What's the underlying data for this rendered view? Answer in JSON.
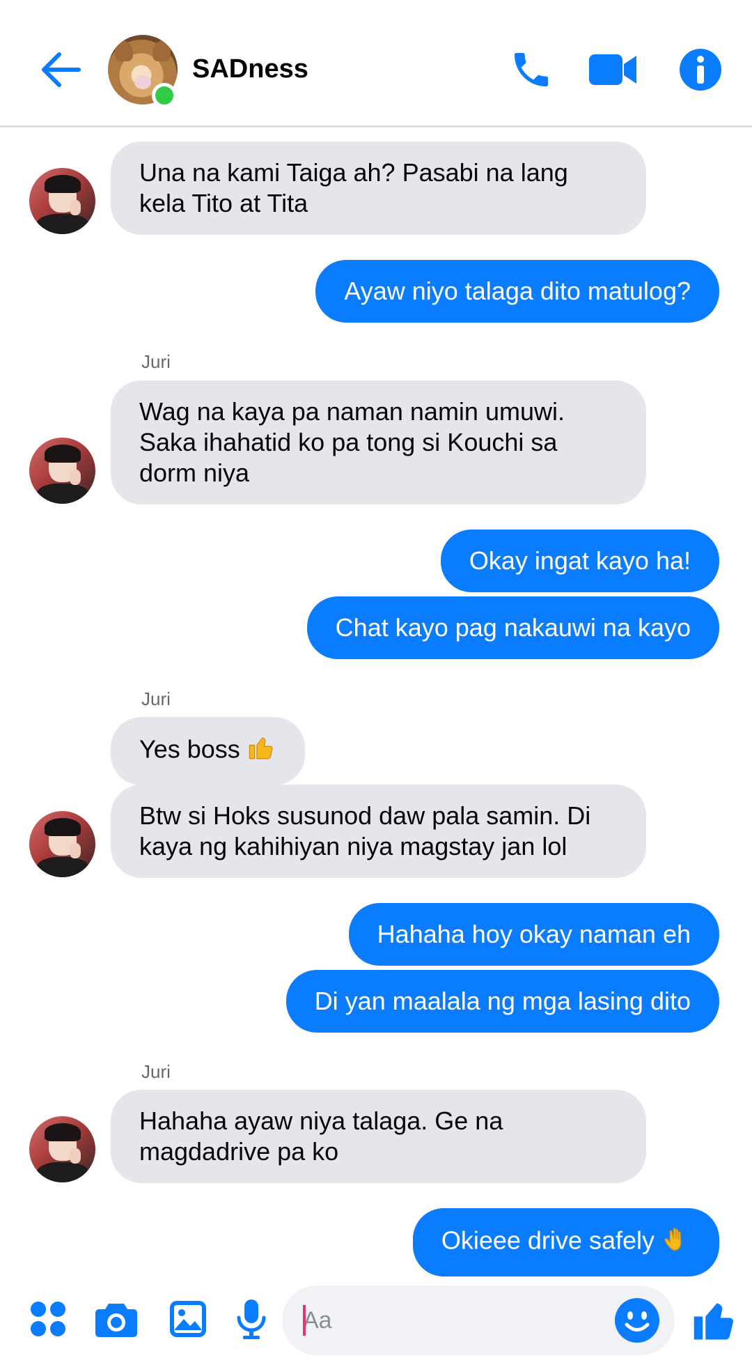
{
  "header": {
    "title": "SADness",
    "back_icon": "arrow-left-icon",
    "actions": [
      "phone-icon",
      "video-camera-icon",
      "info-icon"
    ],
    "accent_color": "#0a7cff",
    "online_color": "#31cc46"
  },
  "messages": [
    {
      "id": 0,
      "side": "in",
      "text": "Una na kami Taiga ah? Pasabi na lang kela Tito at Tita"
    },
    {
      "id": 1,
      "side": "out",
      "text": "Ayaw niyo talaga dito matulog?"
    },
    {
      "id": 2,
      "side": "in",
      "sender": "Juri",
      "text": "Wag na kaya pa naman namin umuwi. Saka ihahatid ko pa tong si Kouchi sa dorm niya"
    },
    {
      "id": 3,
      "side": "out",
      "text": "Okay ingat kayo ha!"
    },
    {
      "id": 4,
      "side": "out",
      "text": "Chat kayo pag nakauwi na kayo"
    },
    {
      "id": 5,
      "side": "in",
      "sender": "Juri",
      "text": "Yes boss",
      "emoji": "thumbs-up-emoji"
    },
    {
      "id": 6,
      "side": "in",
      "text": "Btw si Hoks susunod daw pala samin. Di kaya ng kahihiyan niya magstay jan lol"
    },
    {
      "id": 7,
      "side": "out",
      "text": "Hahaha hoy okay naman eh"
    },
    {
      "id": 8,
      "side": "out",
      "text": "Di yan maalala ng mga lasing dito"
    },
    {
      "id": 9,
      "side": "in",
      "sender": "Juri",
      "text": "Hahaha ayaw niya talaga. Ge na magdadrive pa ko"
    },
    {
      "id": 10,
      "side": "out",
      "text": "Okieee drive safely",
      "emoji": "waving-hand-emoji"
    }
  ],
  "composer": {
    "placeholder": "Aa",
    "value": "",
    "icons": [
      "apps-icon",
      "camera-icon",
      "gallery-icon",
      "microphone-icon",
      "emoji-smile-icon",
      "thumbs-up-icon"
    ]
  },
  "colors": {
    "outgoing_bubble": "#0a7cff",
    "incoming_bubble": "#e4e6eb",
    "sender_name": "#65676b"
  }
}
